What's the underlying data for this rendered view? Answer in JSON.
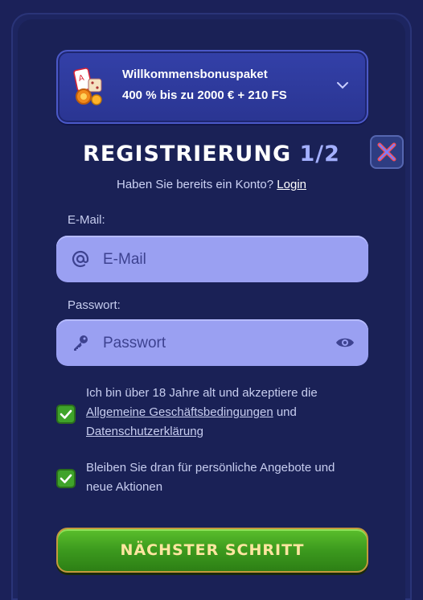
{
  "bonus": {
    "title": "Willkommensbonuspaket",
    "detail": "400 % bis zu 2000 € + 210 FS",
    "icon": "dice-chips-icon",
    "expand_icon": "chevron-down-icon"
  },
  "header": {
    "title": "REGISTRIERUNG",
    "step": "1/2",
    "close_icon": "close-icon"
  },
  "subtitle": {
    "text": "Haben Sie bereits ein Konto?",
    "login_link": "Login"
  },
  "form": {
    "email": {
      "label": "E-Mail:",
      "placeholder": "E-Mail",
      "value": "",
      "icon": "at-icon"
    },
    "password": {
      "label": "Passwort:",
      "placeholder": "Passwort",
      "value": "",
      "icon": "key-icon",
      "toggle_icon": "eye-icon"
    }
  },
  "terms": {
    "checked": true,
    "text_before": "Ich bin über 18 Jahre alt und akzeptiere die",
    "agb_link": "Allgemeine Geschäftsbedingungen",
    "and": "und",
    "privacy_link": "Datenschutzerklärung"
  },
  "offers": {
    "checked": true,
    "text": "Bleiben Sie dran für persönliche Angebote und neue Aktionen"
  },
  "next_button": {
    "label": "NÄCHSTER SCHRITT"
  },
  "colors": {
    "background": "#1b2159",
    "field": "#9aa0f2",
    "accent_green": "#3fa32a",
    "button_text": "#ffe6a0"
  }
}
